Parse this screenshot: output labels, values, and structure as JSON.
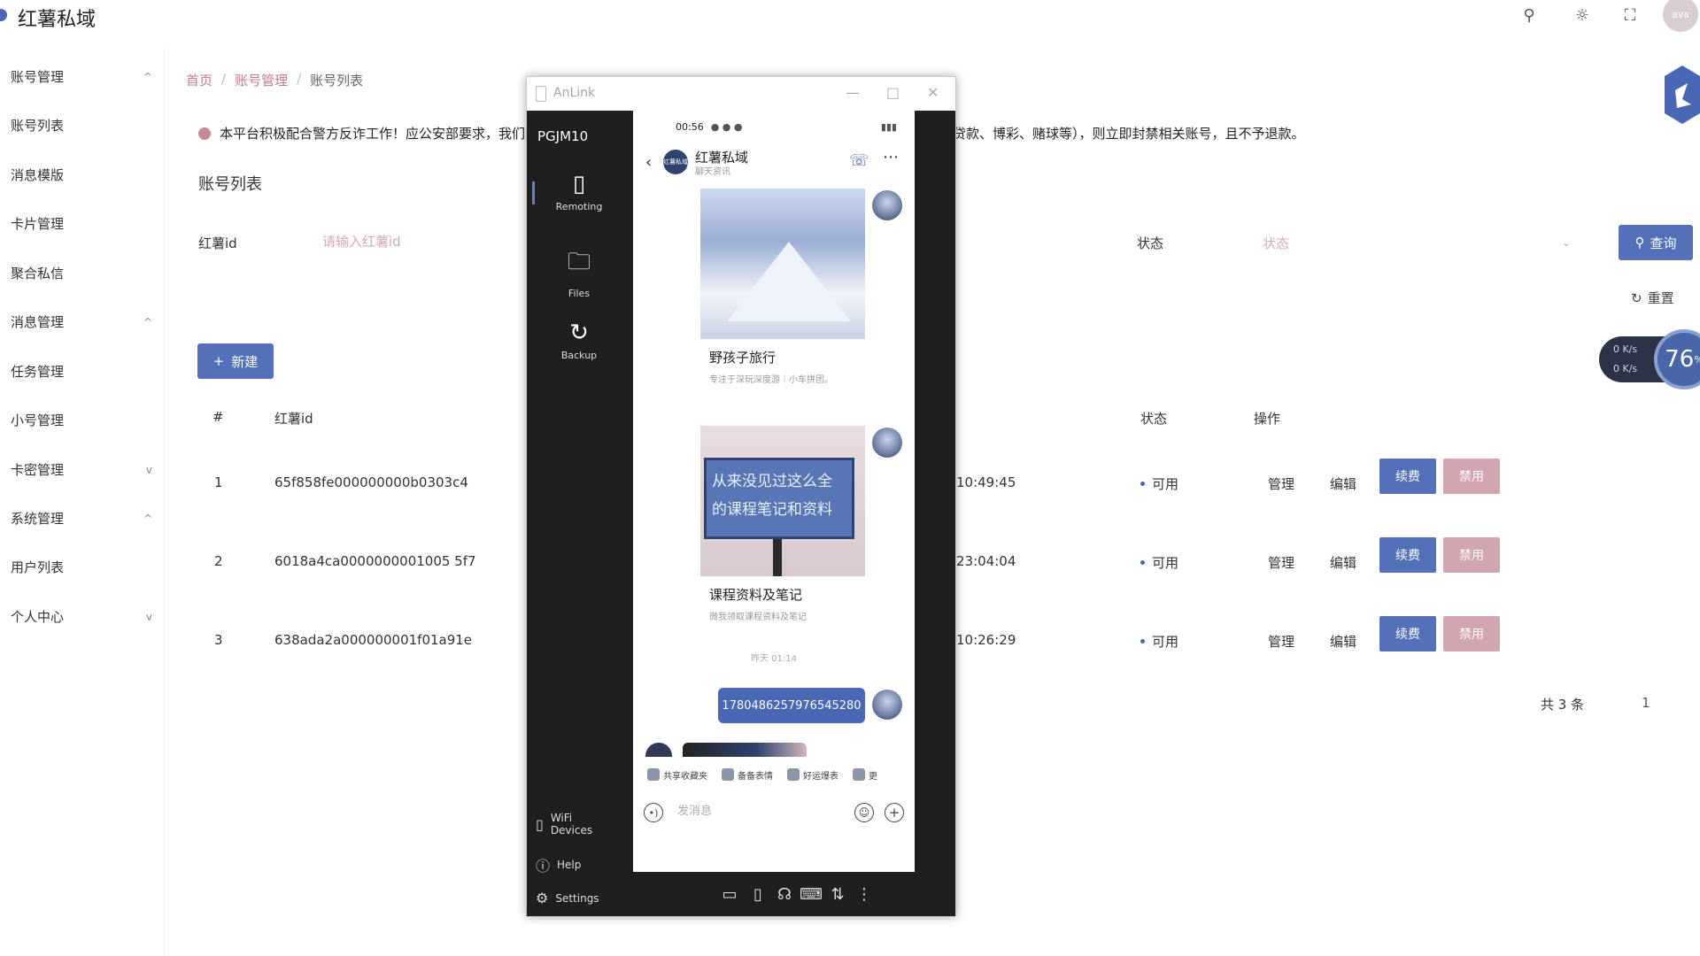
{
  "header": {
    "brand": "红薯私域",
    "avatar_text": "ava"
  },
  "sidebar": {
    "items": [
      {
        "label": "账号管理",
        "chevron": "^"
      },
      {
        "label": "账号列表",
        "chevron": ""
      },
      {
        "label": "消息模版",
        "chevron": ""
      },
      {
        "label": "卡片管理",
        "chevron": ""
      },
      {
        "label": "聚合私信",
        "chevron": ""
      },
      {
        "label": "消息管理",
        "chevron": "^"
      },
      {
        "label": "任务管理",
        "chevron": ""
      },
      {
        "label": "小号管理",
        "chevron": ""
      },
      {
        "label": "卡密管理",
        "chevron": "v"
      },
      {
        "label": "系统管理",
        "chevron": "^"
      },
      {
        "label": "用户列表",
        "chevron": ""
      },
      {
        "label": "个人中心",
        "chevron": "v"
      }
    ]
  },
  "breadcrumb": {
    "home": "首页",
    "level1": "账号管理",
    "level2": "账号列表"
  },
  "notice": {
    "head": "本平台积极配合警方反诈工作！应公安部要求，我们将",
    "tail": "贷款、博彩、赌球等），则立即封禁相关账号，且不予退款。"
  },
  "page": {
    "title": "账号列表"
  },
  "filter": {
    "id_label": "红薯id",
    "id_placeholder": "请输入红薯id",
    "status_label": "状态",
    "status_placeholder": "状态",
    "query_label": "查询",
    "reset_label": "重置",
    "new_label": "新建"
  },
  "table": {
    "headers": {
      "index": "#",
      "id": "红薯id",
      "status": "状态",
      "ops": "操作"
    },
    "rows": [
      {
        "index": "1",
        "id": "65f858fe000000000b0303c4",
        "time": "10:49:45",
        "status": "可用"
      },
      {
        "index": "2",
        "id": "6018a4ca0000000001005 5f7",
        "time": "23:04:04",
        "status": "可用"
      },
      {
        "index": "3",
        "id": "638ada2a000000001f01a91e",
        "time": "10:26:29",
        "status": "可用"
      }
    ],
    "op_manage": "管理",
    "op_edit": "编辑",
    "op_renew": "续费",
    "op_disable": "禁用"
  },
  "pagination": {
    "total": "共 3 条",
    "page": "1"
  },
  "speed_widget": {
    "up": "0 K/s",
    "down": "0 K/s",
    "percent": "76"
  },
  "anlink": {
    "title": "AnLink",
    "device": "PGJM10",
    "nav": [
      {
        "label": "Remoting"
      },
      {
        "label": "Files"
      },
      {
        "label": "Backup"
      }
    ],
    "bottom_nav": [
      {
        "label": "WiFi Devices"
      },
      {
        "label": "Help"
      },
      {
        "label": "Settings"
      }
    ]
  },
  "phone": {
    "time": "00:56",
    "chat_name": "红薯私域",
    "chat_sub": "聊天资讯",
    "avatar_text": "红薯私域",
    "card1_title": "野孩子旅行",
    "card1_desc": "专注于深玩深度游｜小车拼团。",
    "card2_sign": "从来没见过这么全的课程笔记和资料",
    "card2_title": "课程资料及笔记",
    "card2_desc": "微我领取课程资料及笔记",
    "timestamp": "昨天 01:14",
    "bubble_text": "1780486257976545280",
    "quick": [
      "共享收藏夹",
      "备备表情",
      "好运爆表",
      "更"
    ],
    "input_placeholder": "发消息"
  },
  "colors": {
    "primary": "#5470b8",
    "disable": "#d1a6b0",
    "link": "#c97b8b"
  }
}
